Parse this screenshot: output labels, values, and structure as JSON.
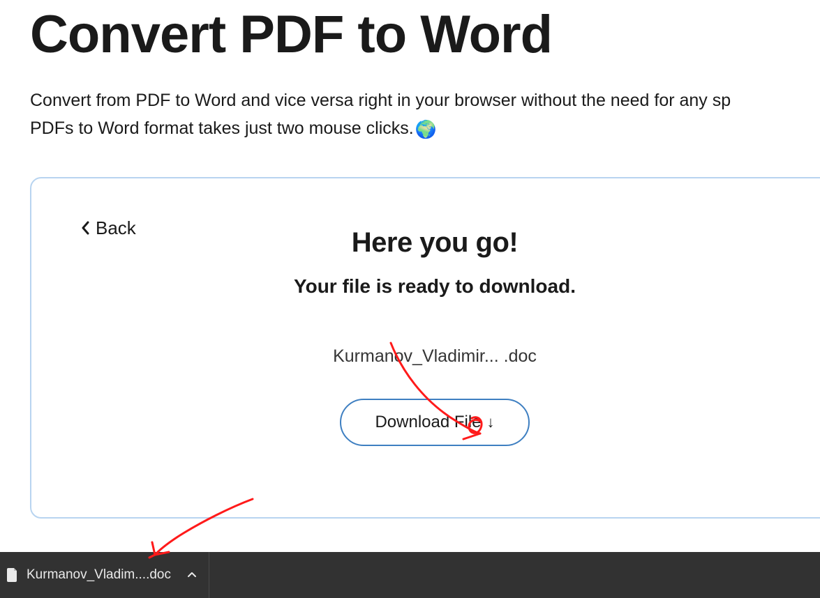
{
  "header": {
    "title": "Convert PDF to Word",
    "subtitle_line1": "Convert from PDF to Word and vice versa right in your browser without the need for any sp",
    "subtitle_line2": "PDFs to Word format takes just two mouse clicks.",
    "globe_emoji": "🌍"
  },
  "card": {
    "back_label": "Back",
    "heading": "Here you go!",
    "ready_text": "Your file is ready to download.",
    "file_name": "Kurmanov_Vladimir...  .doc",
    "download_button_label": "Download File"
  },
  "download_shelf": {
    "item_label": "Kurmanov_Vladim....doc"
  },
  "colors": {
    "card_border": "#b8d4f0",
    "button_border": "#3e7fc1",
    "shelf_bg": "#323232",
    "annotation": "#ff1a1a"
  }
}
